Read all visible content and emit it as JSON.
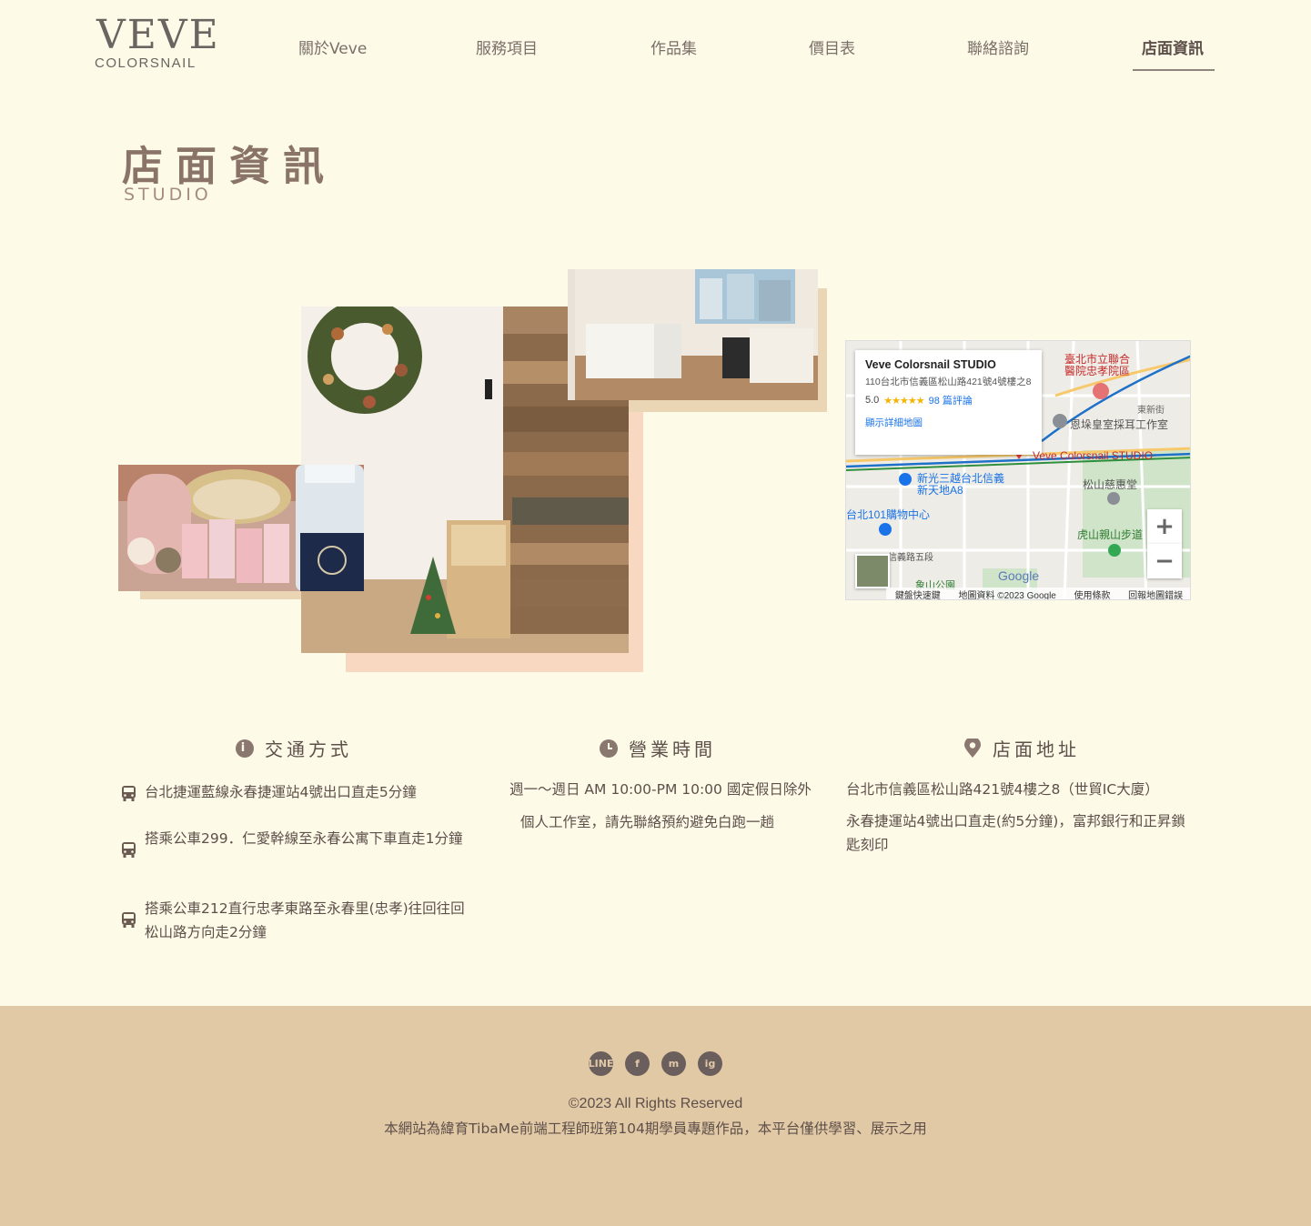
{
  "header": {
    "logo_mark": "VEVE",
    "logo_sub": "COLORSNAIL",
    "nav": [
      "關於Veve",
      "服務項目",
      "作品集",
      "價目表",
      "聯絡諮詢",
      "店面資訊"
    ],
    "active_nav": "店面資訊"
  },
  "page": {
    "title": "店面資訊",
    "subtitle": "STUDIO"
  },
  "map": {
    "place_name": "Veve Colorsnail STUDIO",
    "address": "110台北市信義區松山路421號4號樓之8",
    "rating": "5.0",
    "stars": "★★★★★",
    "reviews": "98 篇評論",
    "detail_link": "顯示詳細地圖",
    "labels": {
      "hospital": "臺北市立聯合醫院忠孝院區",
      "ent": "恩垛皇室採耳工作室",
      "marker": "Veve Colorsnail STUDIO",
      "mall": "新光三越台北信義新天地A8",
      "taipei101": "台北101購物中心",
      "temple": "松山慈惠堂",
      "trail": "虎山親山步道",
      "xinyi_road": "信義路五段",
      "xiangshan": "象山公園",
      "street_east": "東新街"
    },
    "zoom_in": "+",
    "zoom_out": "−",
    "google": "Google",
    "footer": [
      "鍵盤快速鍵",
      "地圖資料 ©2023 Google",
      "使用條款",
      "回報地圖錯誤"
    ]
  },
  "transport": {
    "heading": "交通方式",
    "icon": "info-icon",
    "items": [
      "台北捷運藍線永春捷運站4號出口直走5分鐘",
      "搭乘公車299．仁愛幹線至永春公寓下車直走1分鐘",
      "搭乘公車212直行忠孝東路至永春里(忠孝)往回往回松山路方向走2分鐘"
    ]
  },
  "hours": {
    "heading": "營業時間",
    "icon": "clock-icon",
    "line1": "週一〜週日 AM 10:00-PM 10:00 國定假日除外",
    "line2": "個人工作室，請先聯絡預約避免白跑一趟"
  },
  "address": {
    "heading": "店面地址",
    "icon": "location-pin-icon",
    "line1": "台北市信義區松山路421號4樓之8（世貿IC大廈）",
    "line2": "永春捷運站4號出口直走(約5分鐘)，富邦銀行和正昇鎖匙刻印"
  },
  "footer": {
    "social": [
      "line-icon",
      "facebook-icon",
      "messenger-icon",
      "instagram-icon"
    ],
    "social_text": [
      "LINE",
      "f",
      "m",
      "ig"
    ],
    "copyright": "©2023 All Rights Reserved",
    "disclaimer": "本網站為緯育TibaMe前端工程師班第104期學員專題作品，本平台僅供學習、展示之用"
  },
  "colors": {
    "background": "#fdfbe8",
    "footer": "#e2c9a6",
    "text": "#5d4f49",
    "accent_block_pink": "#f8d8c0",
    "accent_block_tan": "#ead5b5"
  }
}
